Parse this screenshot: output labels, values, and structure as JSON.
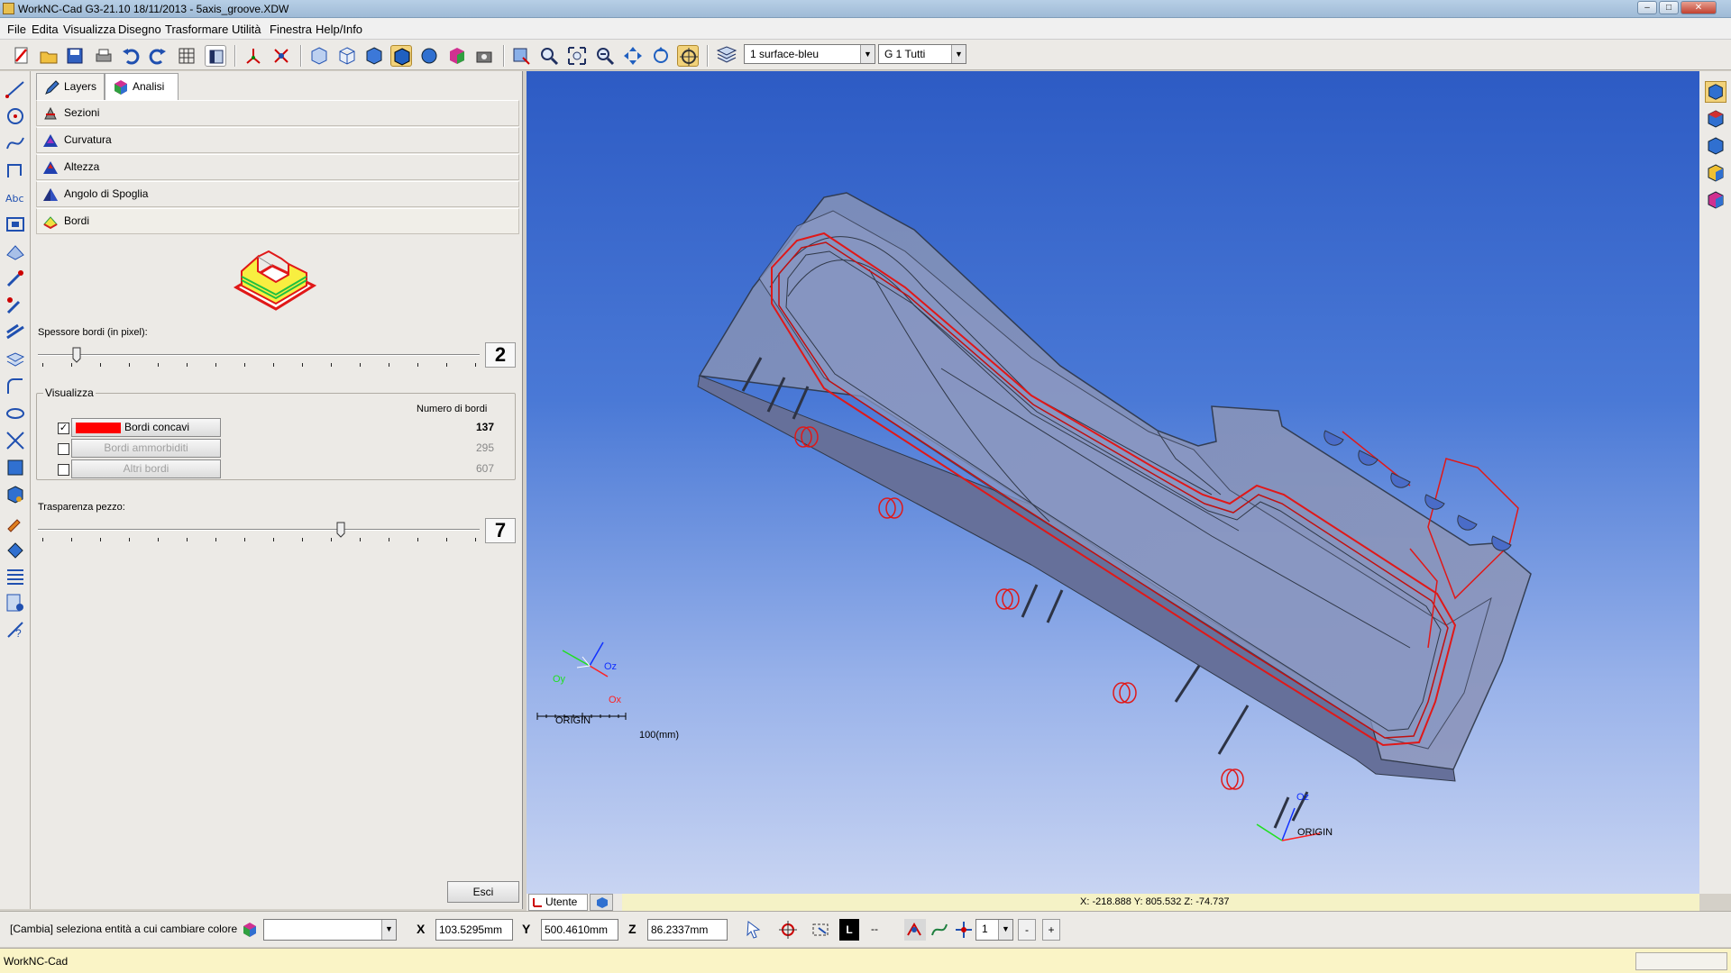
{
  "window": {
    "title": "WorkNC-Cad G3-21.10  18/11/2013 - 5axis_groove.XDW",
    "controls": {
      "minimize": "–",
      "maximize": "□",
      "close": "✕"
    }
  },
  "menu": [
    "File",
    "Edita",
    "Visualizza",
    "Disegno",
    "Trasformare",
    "Utilità",
    "Finestra",
    "Help/Info"
  ],
  "toolbar": {
    "layer_combo": "1   surface-bleu",
    "group_combo": "G   1 Tutti"
  },
  "panel": {
    "tabs": [
      {
        "label": "Layers",
        "icon": "pencil-icon"
      },
      {
        "label": "Analisi",
        "icon": "cube-icon"
      }
    ],
    "sections": [
      {
        "label": "Sezioni",
        "icon": "section-icon"
      },
      {
        "label": "Curvatura",
        "icon": "curvature-icon"
      },
      {
        "label": "Altezza",
        "icon": "height-icon"
      },
      {
        "label": "Angolo di Spoglia",
        "icon": "draft-angle-icon"
      },
      {
        "label": "Bordi",
        "icon": "edges-icon"
      }
    ],
    "edge_thickness": {
      "label": "Spessore bordi (in pixel):",
      "value": "2",
      "position": 0.08
    },
    "visualizza": {
      "title": "Visualizza",
      "count_header": "Numero di bordi",
      "rows": [
        {
          "label": "Bordi concavi",
          "count": "137",
          "checked": true,
          "enabled": true,
          "color": "#ff0000"
        },
        {
          "label": "Bordi ammorbiditi",
          "count": "295",
          "checked": false,
          "enabled": false
        },
        {
          "label": "Altri bordi",
          "count": "607",
          "checked": false,
          "enabled": false
        }
      ]
    },
    "transparency": {
      "label": "Trasparenza pezzo:",
      "value": "7",
      "position": 0.69
    },
    "exit_button": "Esci"
  },
  "viewport": {
    "triad": {
      "oz": "Oz",
      "oy": "Oy",
      "ox": "Ox",
      "origin": "ORIGIN"
    },
    "scale_label": "100(mm)",
    "part_origin": {
      "oz": "Oz",
      "origin": "ORIGIN"
    },
    "coords": "X: -218.888   Y: 805.532   Z: -74.737",
    "tabs": [
      {
        "label": "Utente"
      }
    ]
  },
  "command": {
    "prompt": "[Cambia] seleziona entità a cui cambiare colore",
    "x_label": "X",
    "x_value": "103.5295mm",
    "y_label": "Y",
    "y_value": "500.4610mm",
    "z_label": "Z",
    "z_value": "86.2337mm",
    "l_label": "L",
    "dash_label": "--",
    "stepper_value": "1",
    "minus": "-",
    "plus": "+"
  },
  "status": {
    "text": "WorkNC-Cad"
  },
  "colors": {
    "viewport_top": "#2d5bc4",
    "viewport_bottom": "#c8d4f2",
    "edge_red": "#e01818",
    "status_bg": "#faf4c6"
  }
}
